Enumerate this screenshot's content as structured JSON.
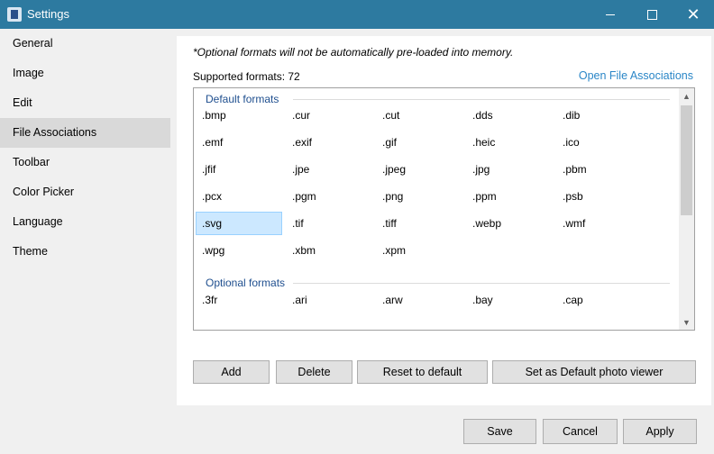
{
  "window": {
    "title": "Settings"
  },
  "titlebar": {
    "close_glyph": "✕"
  },
  "sidebar": {
    "items": [
      "General",
      "Image",
      "Edit",
      "File Associations",
      "Toolbar",
      "Color Picker",
      "Language",
      "Theme"
    ],
    "active_index": 3
  },
  "panel": {
    "note": "*Optional formats will not be automatically pre-loaded into memory.",
    "supported_label": "Supported formats: 72",
    "open_link": "Open File Associations"
  },
  "list": {
    "default_header": "Default formats",
    "default_formats": [
      ".bmp",
      ".cur",
      ".cut",
      ".dds",
      ".dib",
      ".emf",
      ".exif",
      ".gif",
      ".heic",
      ".ico",
      ".jfif",
      ".jpe",
      ".jpeg",
      ".jpg",
      ".pbm",
      ".pcx",
      ".pgm",
      ".png",
      ".ppm",
      ".psb",
      ".svg",
      ".tif",
      ".tiff",
      ".webp",
      ".wmf",
      ".wpg",
      ".xbm",
      ".xpm"
    ],
    "selected": ".svg",
    "optional_header": "Optional formats",
    "optional_formats": [
      ".3fr",
      ".ari",
      ".arw",
      ".bay",
      ".cap"
    ],
    "scroll_up_glyph": "▲",
    "scroll_down_glyph": "▼"
  },
  "actions": {
    "add": "Add",
    "delete": "Delete",
    "reset": "Reset to default",
    "set_default": "Set as Default photo viewer"
  },
  "footer": {
    "save": "Save",
    "cancel": "Cancel",
    "apply": "Apply"
  },
  "colors": {
    "titlebar": "#2d7aa0",
    "link": "#2a86c7",
    "selection": "#cce8ff",
    "group_header": "#1f4f8f"
  }
}
